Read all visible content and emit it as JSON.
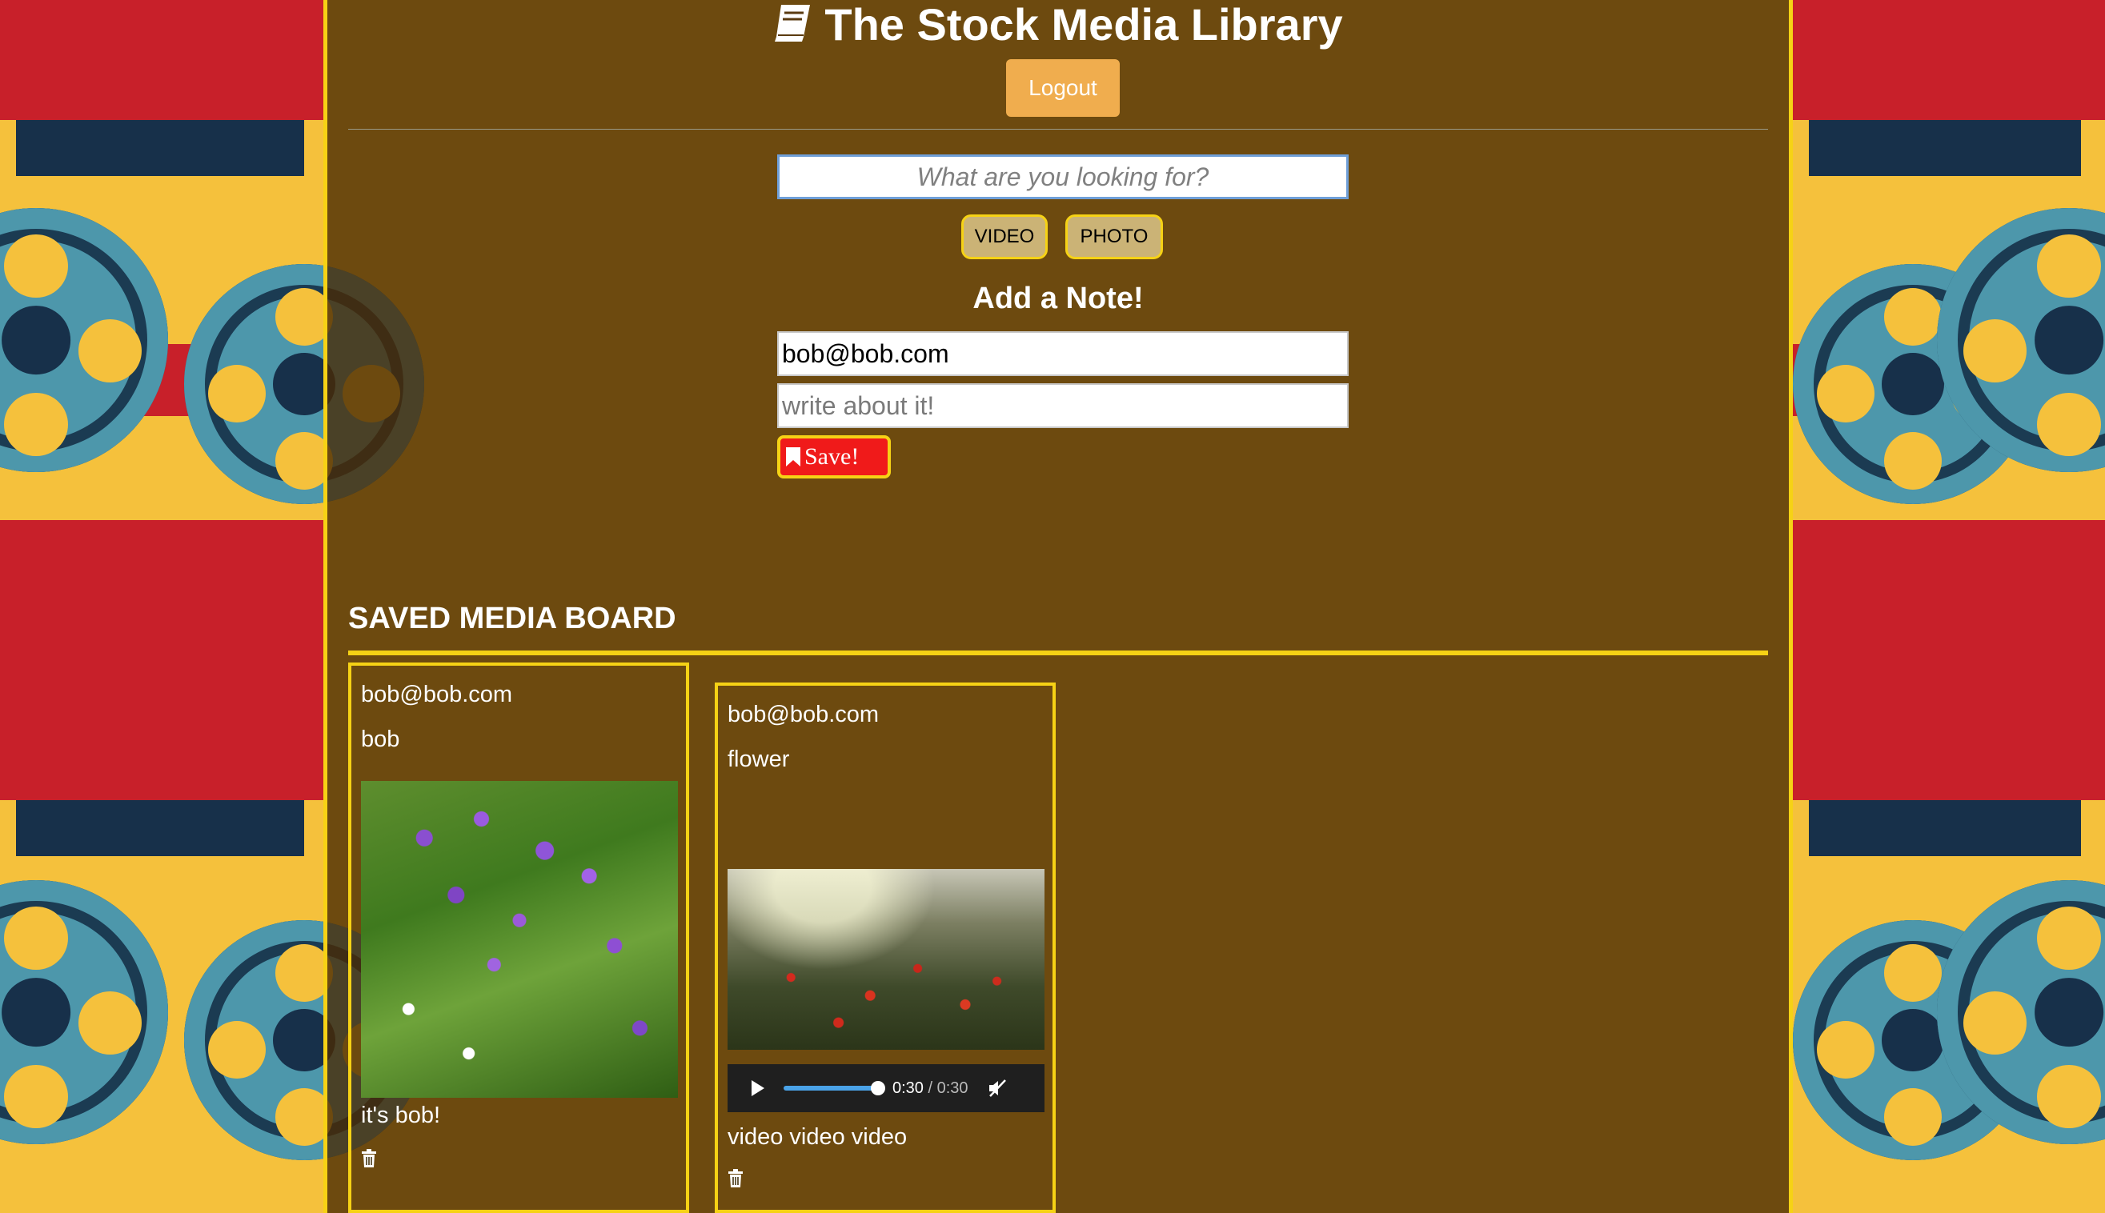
{
  "header": {
    "title": "The Stock Media Library",
    "logout_label": "Logout"
  },
  "search": {
    "placeholder": "What are you looking for?",
    "value": ""
  },
  "media_types": {
    "video_label": "VIDEO",
    "photo_label": "PHOTO"
  },
  "note_form": {
    "heading": "Add a Note!",
    "email_value": "bob@bob.com",
    "note_placeholder": "write about it!",
    "save_label": "Save!"
  },
  "board": {
    "title": "SAVED MEDIA BOARD",
    "cards": [
      {
        "user": "bob@bob.com",
        "title": "bob",
        "media_type": "photo",
        "note": "it's bob!"
      },
      {
        "user": "bob@bob.com",
        "title": "flower",
        "media_type": "video",
        "current_time": "0:30",
        "duration": "/ 0:30",
        "progress": 1.0,
        "note": "video video video"
      }
    ]
  },
  "colors": {
    "accent_yellow": "#f6d215",
    "logout_orange": "#f0ad4e",
    "save_red": "#f01a1a"
  }
}
